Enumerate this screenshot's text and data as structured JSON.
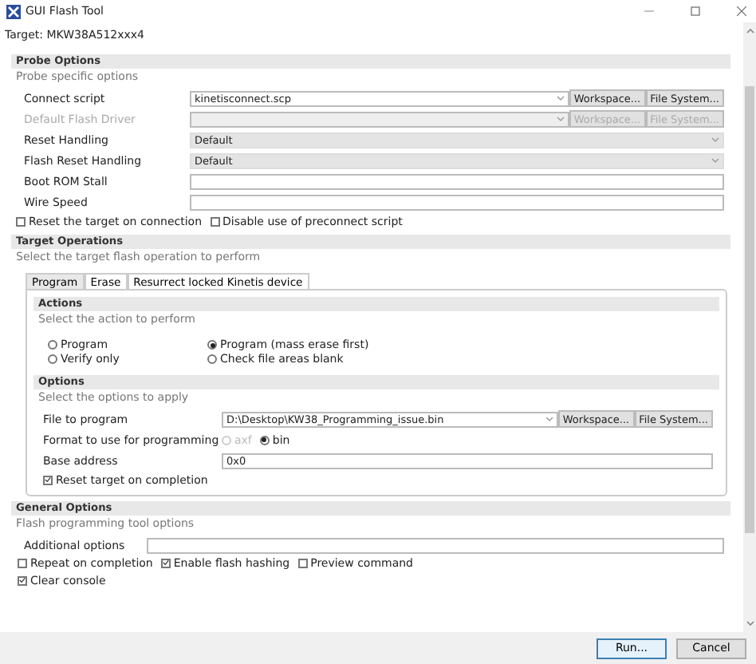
{
  "window": {
    "title": "GUI Flash Tool"
  },
  "target": "Target: MKW38A512xxx4",
  "probe_options": {
    "title": "Probe Options",
    "subtitle": "Probe specific options",
    "fields": [
      {
        "kind": "combo",
        "label": "Connect script",
        "value": "kinetisconnect.scp",
        "disabled": false,
        "buttons": [
          "Workspace...",
          "File System..."
        ]
      },
      {
        "kind": "combo",
        "label": "Default Flash Driver",
        "disabled": true,
        "buttons": [
          "Workspace...",
          "File System..."
        ]
      },
      {
        "kind": "select",
        "label": "Reset Handling",
        "value": "Default"
      },
      {
        "kind": "select",
        "label": "Flash Reset Handling",
        "value": "Default"
      },
      {
        "kind": "text",
        "label": "Boot ROM Stall"
      },
      {
        "kind": "text",
        "label": "Wire Speed"
      }
    ],
    "checkbox_rows": [
      [
        {
          "label": "Reset the target on connection",
          "checked": false
        },
        {
          "label": "Disable use of preconnect script",
          "checked": false
        }
      ]
    ]
  },
  "target_operations": {
    "title": "Target Operations",
    "subtitle": "Select the target flash operation to perform",
    "tabs": [
      {
        "label": "Program",
        "selected": true
      },
      {
        "label": "Erase",
        "selected": false
      },
      {
        "label": "Resurrect locked Kinetis device",
        "selected": false
      }
    ],
    "actions": {
      "title": "Actions",
      "subtitle": "Select the action to perform",
      "radios": [
        {
          "label": "Program",
          "selected": false
        },
        {
          "label": "Program (mass erase first)",
          "selected": true
        },
        {
          "label": "Verify only",
          "selected": false
        },
        {
          "label": "Check file areas blank",
          "selected": false
        }
      ]
    },
    "options": {
      "title": "Options",
      "subtitle": "Select the options to apply",
      "fields": [
        {
          "kind": "combo",
          "label": "File to program",
          "value": "D:\\Desktop\\KW38_Programming_issue.bin",
          "disabled": false,
          "buttons": [
            "Workspace...",
            "File System..."
          ]
        },
        {
          "kind": "radios",
          "label": "Format to use for programming",
          "radios": [
            {
              "label": "axf",
              "selected": false,
              "disabled": true
            },
            {
              "label": "bin",
              "selected": true,
              "disabled": false
            }
          ]
        },
        {
          "kind": "text",
          "label": "Base address",
          "value": "0x0"
        }
      ],
      "checkbox_rows": [
        [
          {
            "label": "Reset target on completion",
            "checked": true
          }
        ]
      ]
    }
  },
  "general_options": {
    "title": "General Options",
    "subtitle": "Flash programming tool options",
    "fields": [
      {
        "kind": "text",
        "label": "Additional options"
      }
    ],
    "checkbox_rows": [
      [
        {
          "label": "Repeat on completion",
          "checked": false
        },
        {
          "label": "Enable flash hashing",
          "checked": true
        },
        {
          "label": "Preview command",
          "checked": false
        }
      ],
      [
        {
          "label": "Clear console",
          "checked": true
        }
      ]
    ]
  },
  "buttons": [
    {
      "label": "Run...",
      "default": true
    },
    {
      "label": "Cancel",
      "default": false
    }
  ]
}
